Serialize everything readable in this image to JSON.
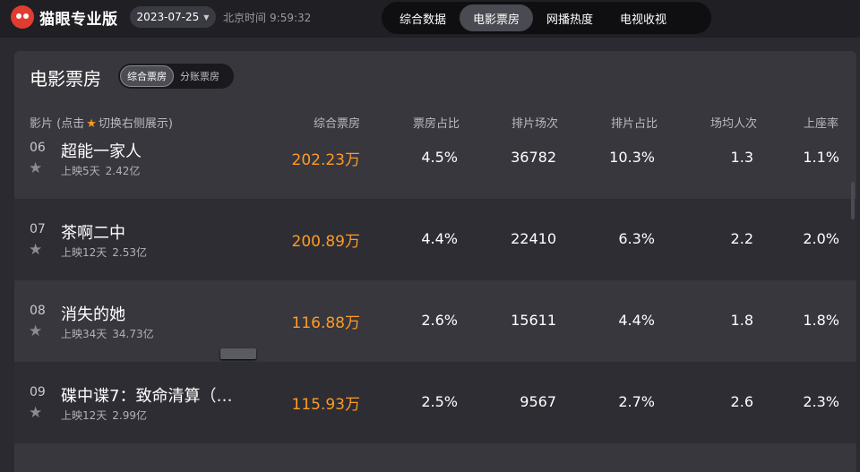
{
  "brand": {
    "name": "猫眼专业版"
  },
  "date": {
    "value": "2023-07-25"
  },
  "clock": {
    "label": "北京时间",
    "time": "9:59:32"
  },
  "nav": {
    "tabs": [
      {
        "label": "综合数据"
      },
      {
        "label": "电影票房",
        "active": true
      },
      {
        "label": "网播热度"
      },
      {
        "label": "电视收视"
      }
    ]
  },
  "panel": {
    "title": "电影票房",
    "subtabs": [
      {
        "label": "综合票房",
        "active": true
      },
      {
        "label": "分账票房"
      }
    ]
  },
  "table": {
    "headers": {
      "film_prefix": "影片 (点击",
      "film_suffix": "切换右侧展示)",
      "gross": "综合票房",
      "share": "票房占比",
      "shows": "排片场次",
      "show_pct": "排片占比",
      "avg": "场均人次",
      "occupancy": "上座率"
    },
    "rows": [
      {
        "rank": "06",
        "name": "超能一家人",
        "days": "上映5天",
        "total": "2.42亿",
        "gross": "202.23万",
        "share": "4.5%",
        "shows": "36782",
        "show_pct": "10.3%",
        "avg": "1.3",
        "occupancy": "1.1%"
      },
      {
        "rank": "07",
        "name": "茶啊二中",
        "days": "上映12天",
        "total": "2.53亿",
        "gross": "200.89万",
        "share": "4.4%",
        "shows": "22410",
        "show_pct": "6.3%",
        "avg": "2.2",
        "occupancy": "2.0%"
      },
      {
        "rank": "08",
        "name": "消失的她",
        "days": "上映34天",
        "total": "34.73亿",
        "gross": "116.88万",
        "share": "2.6%",
        "shows": "15611",
        "show_pct": "4.4%",
        "avg": "1.8",
        "occupancy": "1.8%"
      },
      {
        "rank": "09",
        "name": "碟中谍7：致命清算（…",
        "days": "上映12天",
        "total": "2.99亿",
        "gross": "115.93万",
        "share": "2.5%",
        "shows": "9567",
        "show_pct": "2.7%",
        "avg": "2.6",
        "occupancy": "2.3%"
      }
    ]
  },
  "icons": {
    "logo": "cat-logo-icon",
    "date_toggle": "chevron-down-icon",
    "favorite": "star-icon"
  },
  "colors": {
    "accent": "#ff9b26",
    "brand": "#e03c31",
    "star_active": "#ff9a1f"
  }
}
